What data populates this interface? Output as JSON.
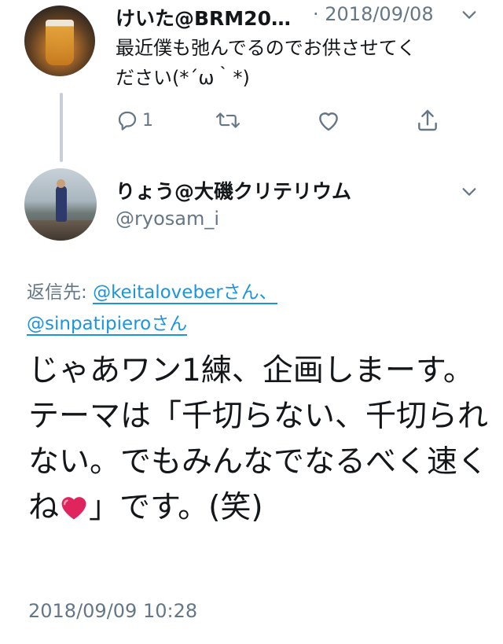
{
  "tweet_parent": {
    "author_name": "けいた@BRM20…",
    "date": "· 2018/09/08",
    "text_line1": "最近僕も弛んでるのでお供させてく",
    "text_line2": "ださい(*´ω｀*)",
    "reply_count": "1"
  },
  "tweet_main": {
    "author_name": "りょう@大磯クリテリウム",
    "handle": "@ryosam_i",
    "reply_to_label": "返信先: ",
    "reply_to_user1": "@keitaloveber",
    "reply_to_user1_suffix": "さん、",
    "reply_to_user2": "@sinpatipiero",
    "reply_to_user2_suffix": "さん",
    "text_part1": "じゃあワン1練、企画しまーす。\nテーマは「千切らない、千切られない。でもみんなでなるべく速くね",
    "text_part2": "」です。(笑)",
    "timestamp": "2018/09/09 10:28"
  },
  "colors": {
    "text": "#14171a",
    "secondary": "#657786",
    "link": "#1b95e0",
    "thread_line": "#c4cfd6",
    "heart": "#e0245e"
  },
  "icons": [
    "reply-icon",
    "retweet-icon",
    "like-icon",
    "share-icon",
    "chevron-down-icon",
    "heart-emoji"
  ]
}
